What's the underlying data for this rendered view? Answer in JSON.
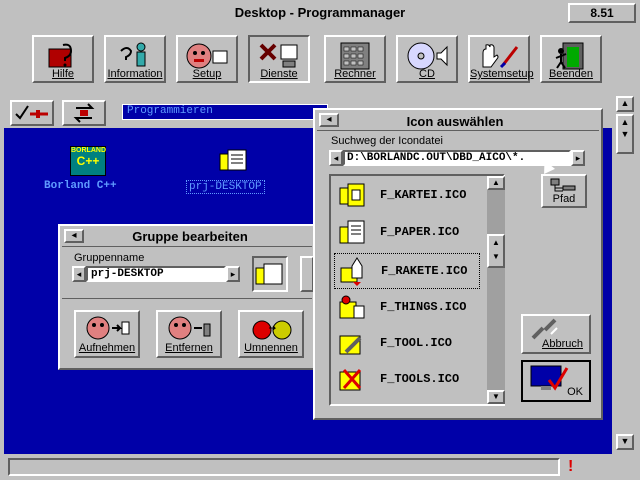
{
  "window": {
    "title": "Desktop - Programmanager",
    "version": "8.51"
  },
  "toolbar": [
    {
      "label": "Hilfe",
      "icon": "help-book-icon"
    },
    {
      "label": "Information",
      "icon": "info-person-icon"
    },
    {
      "label": "Setup",
      "icon": "setup-face-icon"
    },
    {
      "label": "Dienste",
      "icon": "tools-icon"
    },
    {
      "label": "Rechner",
      "icon": "calculator-icon"
    },
    {
      "label": "CD",
      "icon": "cd-icon"
    },
    {
      "label": "Systemsetup",
      "icon": "hand-pen-icon"
    },
    {
      "label": "Beenden",
      "icon": "exit-icon"
    }
  ],
  "desktop": {
    "input_value": "Programmieren",
    "icons": [
      {
        "label": "Borland C++",
        "badge": "BORLAND",
        "badge2": "C++"
      },
      {
        "label": "prj-DESKTOP"
      }
    ]
  },
  "gruppe": {
    "title": "Gruppe bearbeiten",
    "field_label": "Gruppenname",
    "field_value": "prj-DESKTOP",
    "buttons": [
      "Aufnehmen",
      "Entfernen",
      "Umnennen"
    ]
  },
  "icon_dialog": {
    "title": "Icon auswählen",
    "path_label": "Suchweg der Icondatei",
    "path_value": "D:\\BORLANDC.OUT\\DBD_AICO\\*.",
    "pfad_label": "Pfad",
    "files": [
      "F_KARTEI.ICO",
      "F_PAPER.ICO",
      "F_RAKETE.ICO",
      "F_THINGS.ICO",
      "F_TOOL.ICO",
      "F_TOOLS.ICO"
    ],
    "selected_index": 2,
    "cancel_label": "Abbruch",
    "ok_label": "OK"
  },
  "colors": {
    "desktop_bg": "#0000a8",
    "face": "#c0c0c0",
    "accent_text": "#5f9bff"
  }
}
